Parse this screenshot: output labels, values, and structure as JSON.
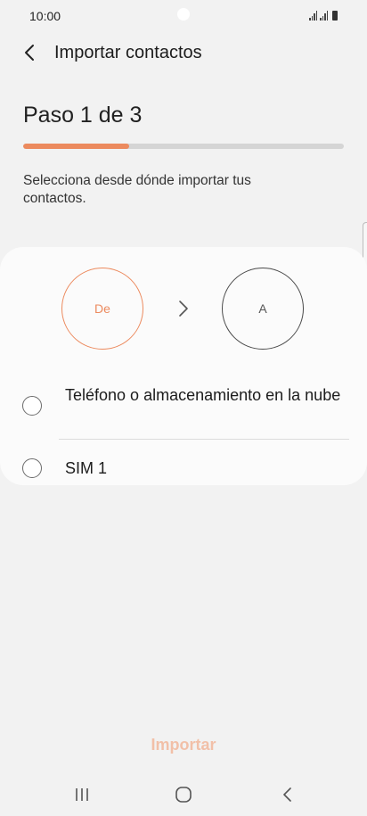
{
  "status_bar": {
    "time": "10:00"
  },
  "header": {
    "back_icon": "chevron-left-icon",
    "title": "Importar contactos"
  },
  "step": {
    "title": "Paso 1 de 3",
    "progress_fraction": 0.33
  },
  "instruction": "Selecciona desde dónde importar tus contactos.",
  "flow": {
    "from_label": "De",
    "to_label": "A",
    "from_color": "#ec8a5e",
    "to_color": "#4a4a4a"
  },
  "options": [
    {
      "label": "Teléfono o almacenamiento en la nube",
      "selected": false
    },
    {
      "label": "SIM 1",
      "selected": false
    }
  ],
  "footer": {
    "import_label": "Importar",
    "import_color": "#f2c0a8",
    "import_enabled": false
  },
  "nav_bar": {
    "icons": [
      "recents-icon",
      "home-icon",
      "back-icon"
    ]
  },
  "colors": {
    "accent": "#ec8a5e",
    "background": "#f2f2f2",
    "card": "#fbfbfb"
  }
}
